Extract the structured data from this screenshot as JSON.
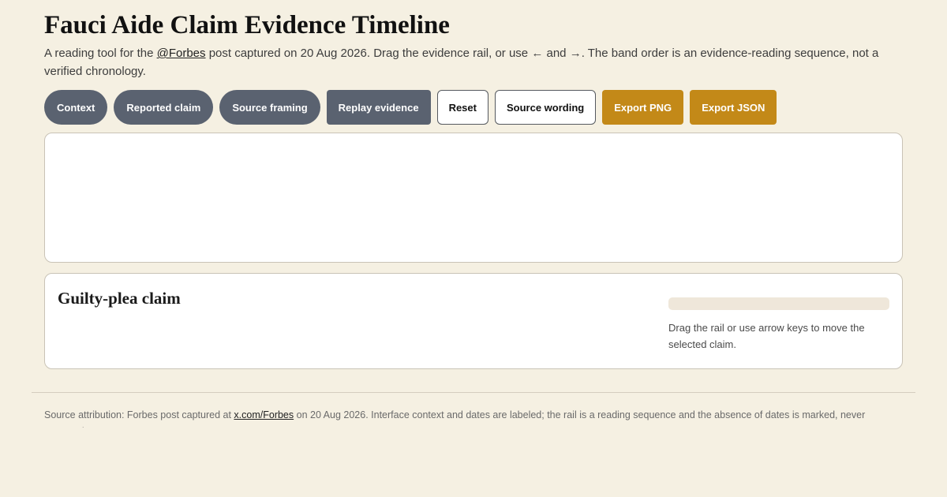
{
  "header": {
    "title": "Fauci Aide Claim Evidence Timeline",
    "intro_prefix": "A reading tool for the ",
    "intro_link": "@Forbes",
    "intro_mid": " post captured on 20 Aug 2026. Drag the evidence rail, or use ",
    "left_arrow": "←",
    "intro_and": " and ",
    "right_arrow": "→",
    "intro_suffix": ". The band order is an evidence-reading sequence, not a verified chronology."
  },
  "toolbar": {
    "context": "Context",
    "reported_claim": "Reported claim",
    "source_framing": "Source framing",
    "replay": "Replay evidence",
    "reset": "Reset",
    "source_wording": "Source wording",
    "export_png": "Export PNG",
    "export_json": "Export JSON"
  },
  "detail": {
    "title": "Guilty-plea claim",
    "hint": "Drag the rail or use arrow keys to move the selected claim."
  },
  "footer": {
    "prefix": "Source attribution: Forbes post captured at ",
    "link": "x.com/Forbes",
    "suffix": " on 20 Aug 2026. Interface context and dates are labeled; the rail is a reading sequence and the absence of dates is marked, never assumed."
  },
  "colors": {
    "background": "#f5f0e2",
    "slate_button": "#5a6270",
    "gold_button": "#c38918",
    "rail": "#efe7da"
  }
}
